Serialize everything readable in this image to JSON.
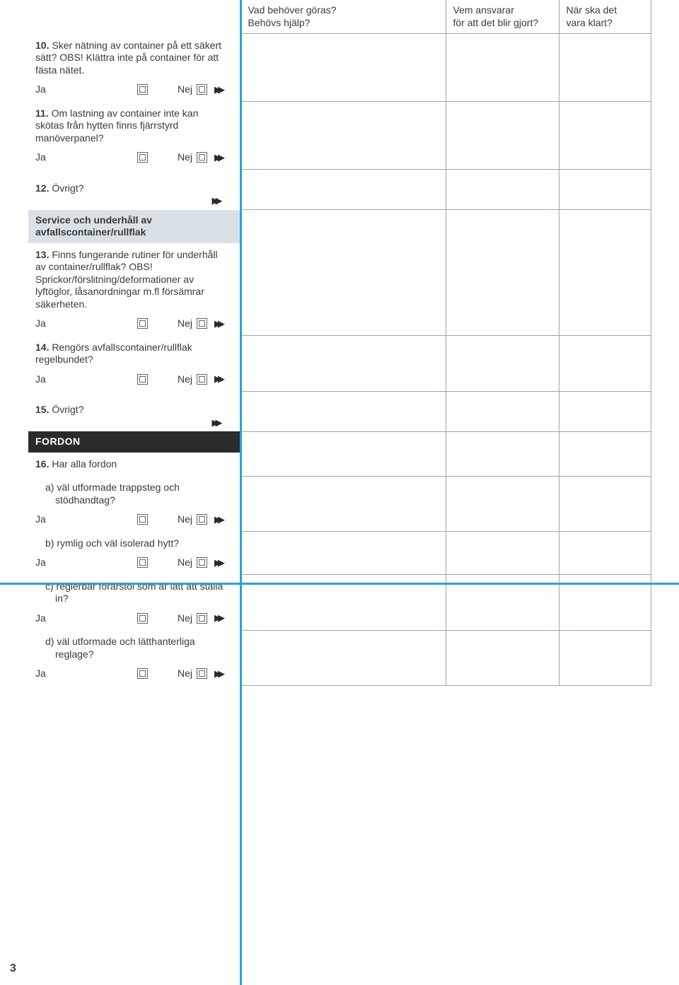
{
  "header": {
    "col2_l1": "Vad behöver göras?",
    "col2_l2": "Behövs hjälp?",
    "col3_l1": "Vem ansvarar",
    "col3_l2": "för att det blir gjort?",
    "col4_l1": "När ska det",
    "col4_l2": "vara klart?"
  },
  "labels": {
    "ja": "Ja",
    "nej": "Nej"
  },
  "q10": {
    "num": "10.",
    "text": " Sker nätning av container på ett säkert sätt? OBS! Klättra inte på container för att fästa nätet."
  },
  "q11": {
    "num": "11.",
    "text": " Om lastning av container inte kan skötas från hytten finns fjärrstyrd manöverpanel?"
  },
  "q12": {
    "num": "12.",
    "text": " Övrigt?"
  },
  "sub1": "Service och underhåll av avfallscontainer/rullflak",
  "q13": {
    "num": "13.",
    "text": " Finns fungerande rutiner för underhåll av container/rullflak? OBS! Sprickor/förslitning/deformationer av lyftöglor, låsanordningar m.fl försämrar säkerheten."
  },
  "q14": {
    "num": "14.",
    "text": " Rengörs avfallscontainer/rullflak regelbundet?"
  },
  "q15": {
    "num": "15.",
    "text": " Övrigt?"
  },
  "section_fordon": "FORDON",
  "q16": {
    "num": "16.",
    "text": " Har alla fordon",
    "a": "a) väl utformade trappsteg och stödhandtag?",
    "b": "b) rymlig och väl isolerad hytt?",
    "c": "c) reglerbar förarstol som är lätt att ställa in?",
    "d": "d) väl utformade och lätthanterliga reglage?"
  },
  "page_number": "3"
}
